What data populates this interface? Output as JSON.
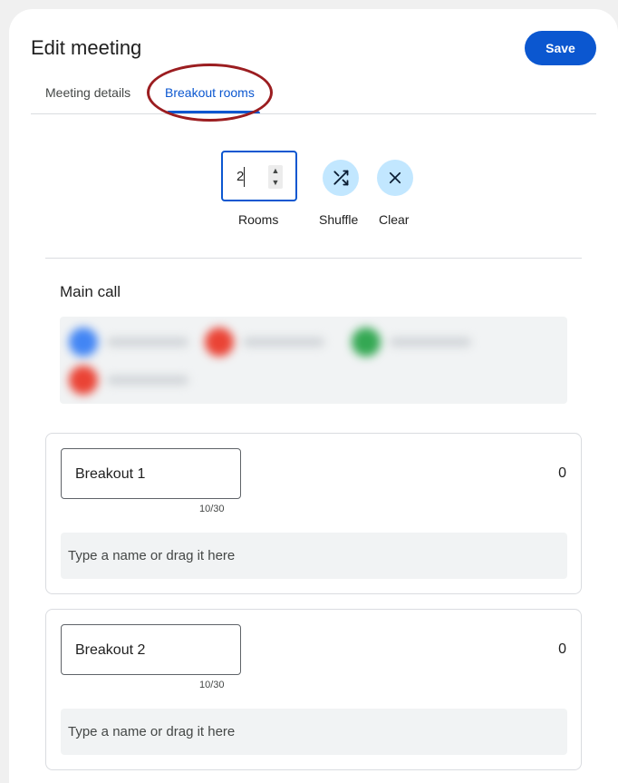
{
  "header": {
    "title": "Edit meeting",
    "save_label": "Save"
  },
  "tabs": [
    {
      "label": "Meeting details",
      "active": false
    },
    {
      "label": "Breakout rooms",
      "active": true
    }
  ],
  "controls": {
    "rooms_value": "2",
    "rooms_label": "Rooms",
    "shuffle_label": "Shuffle",
    "clear_label": "Clear",
    "shuffle_icon": "shuffle-icon",
    "clear_icon": "close-icon"
  },
  "main_call": {
    "heading": "Main call",
    "participants_blurred": true,
    "avatar_colors": [
      "#4285f4",
      "#ea4335",
      "#34a853",
      "#ea4335"
    ]
  },
  "rooms": [
    {
      "name": "Breakout 1",
      "char_count": "10/30",
      "participant_count": "0",
      "drop_placeholder": "Type a name or drag it here"
    },
    {
      "name": "Breakout 2",
      "char_count": "10/30",
      "participant_count": "0",
      "drop_placeholder": "Type a name or drag it here"
    }
  ],
  "colors": {
    "accent": "#0b57d0",
    "icon_button_bg": "#c2e7ff",
    "annotation": "#9b1d20"
  }
}
